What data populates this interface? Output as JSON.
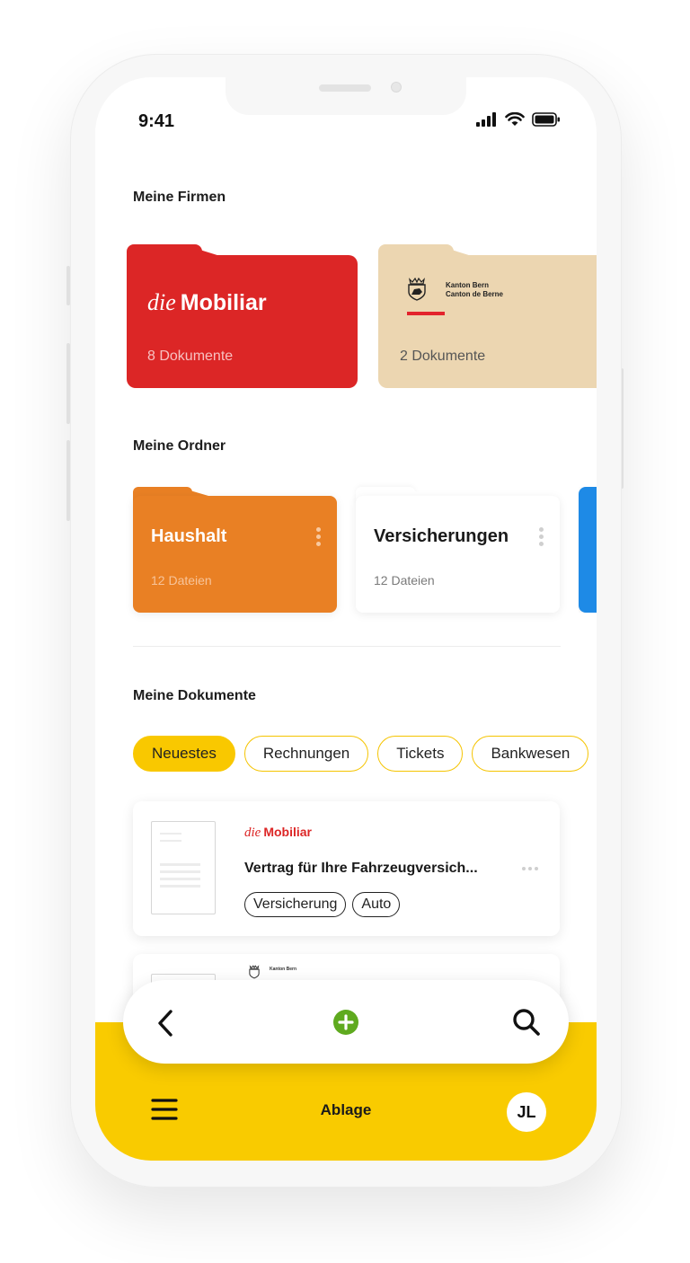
{
  "status_bar": {
    "time": "9:41"
  },
  "sections": {
    "firms_title": "Meine Firmen",
    "folders_title": "Meine Ordner",
    "documents_title": "Meine Dokumente"
  },
  "firms": [
    {
      "logo_prefix": "die",
      "logo_name": "Mobiliar",
      "count": "8 Dokumente",
      "color": "#dc2626"
    },
    {
      "logo_line1": "Kanton Bern",
      "logo_line2": "Canton de Berne",
      "count": "2 Dokumente",
      "color": "#ecd6b1"
    }
  ],
  "folders": [
    {
      "name": "Haushalt",
      "count": "12 Dateien",
      "color": "#e98024"
    },
    {
      "name": "Versicherungen",
      "count": "12 Dateien",
      "color": "#ffffff"
    },
    {
      "color": "#1e8ae6"
    }
  ],
  "filters": [
    "Neuestes",
    "Rechnungen",
    "Tickets",
    "Bankwesen"
  ],
  "documents": [
    {
      "brand_prefix": "die",
      "brand_name": "Mobiliar",
      "title": "Vertrag für Ihre Fahrzeugversich...",
      "tags": [
        "Versicherung",
        "Auto"
      ]
    },
    {
      "brand_text": "Kanton Bern"
    }
  ],
  "bottom_nav": {
    "title": "Ablage",
    "avatar_initials": "JL"
  },
  "colors": {
    "accent": "#f9cb00",
    "add_button": "#5faa1f"
  }
}
